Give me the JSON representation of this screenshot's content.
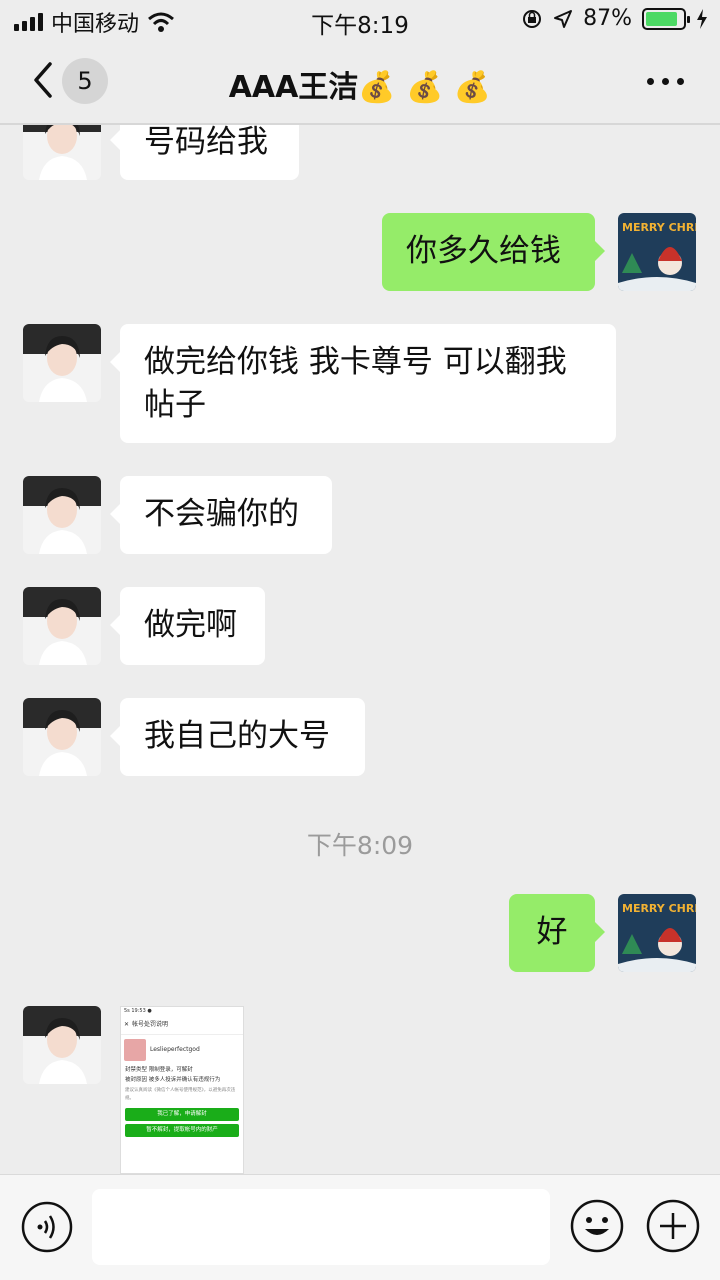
{
  "status_bar": {
    "carrier": "中国移动",
    "time": "下午8:19",
    "battery_percent": "87%",
    "battery_level": 0.87,
    "icons": [
      "signal-icon",
      "wifi-icon",
      "rotation-lock-icon",
      "location-icon",
      "battery-icon",
      "charging-icon"
    ]
  },
  "nav": {
    "unread_count": "5",
    "title": "AAA王洁💰 💰 💰"
  },
  "messages": [
    {
      "side": "left",
      "text": "号码给我"
    },
    {
      "side": "right",
      "text": "你多久给钱"
    },
    {
      "side": "left",
      "text": "做完给你钱 我卡尊号 可以翻我帖子"
    },
    {
      "side": "left",
      "text": "不会骗你的"
    },
    {
      "side": "left",
      "text": "做完啊"
    },
    {
      "side": "left",
      "text": "我自己的大号"
    },
    {
      "side": "right",
      "text": "好"
    }
  ],
  "timestamp": "下午8:09",
  "avatar_art": {
    "right_avatar_text": "MERRY CHRISTMAS"
  },
  "shared_image": {
    "status": "5s 19:53 ●",
    "header": "帐号处罚说明",
    "username": "Leslieperfectgod",
    "row1": "封禁类型  限制登录，可解封",
    "row2": "被封原因  被多人投诉并确认有违规行为",
    "note": "建议认真阅读《微信个人帐号使用规范》，以避免再次违规。",
    "button1": "我已了解，申请解封",
    "button2": "暂不解封，提取帐号内的财产"
  },
  "colors": {
    "background": "#ededed",
    "bubble_self": "#95ec69",
    "bubble_other": "#ffffff",
    "timestamp": "#9b9b9b",
    "battery": "#4cd964"
  }
}
